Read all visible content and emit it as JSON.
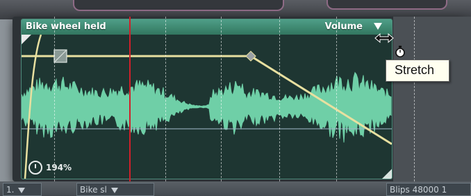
{
  "clip": {
    "name": "Bike wheel held",
    "parameter": "Volume",
    "stretch_percent": "194%"
  },
  "tooltip": {
    "text": "Stretch"
  },
  "bottom_track": {
    "segments": [
      {
        "label": "1.",
        "has_dropdown": true
      },
      {
        "label": "Bike sl",
        "has_dropdown": true
      },
      {
        "label": "Blips 48000 1",
        "has_dropdown": false
      }
    ]
  },
  "colors": {
    "clip_header": "#3f8f77",
    "waveform": "#6fcfa7",
    "volume_envelope": "#e8e0a0",
    "playhead": "#d0202a",
    "tooltip_bg": "#fffff0"
  }
}
